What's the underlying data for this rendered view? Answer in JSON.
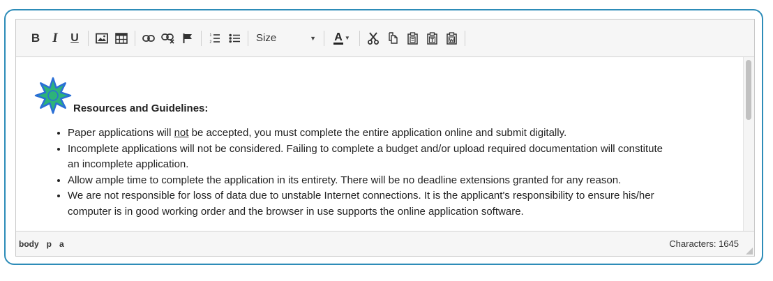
{
  "toolbar": {
    "bold_label": "B",
    "italic_label": "I",
    "underline_label": "U",
    "font_size": {
      "label": "Size"
    },
    "text_color": {
      "label": "A",
      "color": "#222222"
    },
    "icons": [
      "bold-icon",
      "italic-icon",
      "underline-icon",
      "image-icon",
      "table-icon",
      "link-icon",
      "unlink-icon",
      "anchor-flag-icon",
      "numbered-list-icon",
      "bulleted-list-icon",
      "text-color-icon",
      "cut-icon",
      "copy-icon",
      "paste-icon",
      "paste-text-icon",
      "paste-from-word-icon"
    ]
  },
  "content": {
    "heading": "Resources and Guidelines:",
    "items": [
      {
        "before": "Paper applications will ",
        "underlined": "not",
        "after": " be accepted, you must complete the entire application online and submit digitally."
      },
      {
        "before": "Incomplete applications will not be considered. Failing to complete a budget and/or upload required documentation will constitute an incomplete application.",
        "underlined": "",
        "after": ""
      },
      {
        "before": "Allow ample time to complete the application in its entirety. There will be no deadline extensions granted for any reason.",
        "underlined": "",
        "after": ""
      },
      {
        "before": "We are not responsible for loss of data due to unstable Internet connections. It is the applicant's responsibility to ensure his/her computer is in good working order and the browser in use supports the online application software.",
        "underlined": "",
        "after": ""
      }
    ]
  },
  "statusbar": {
    "path": [
      "body",
      "p",
      "a"
    ],
    "characters": "Characters: 1645"
  },
  "colors": {
    "frame_border": "#2d8cb8",
    "logo_fill": "#2db37a",
    "logo_ring": "#2a6fd6"
  }
}
